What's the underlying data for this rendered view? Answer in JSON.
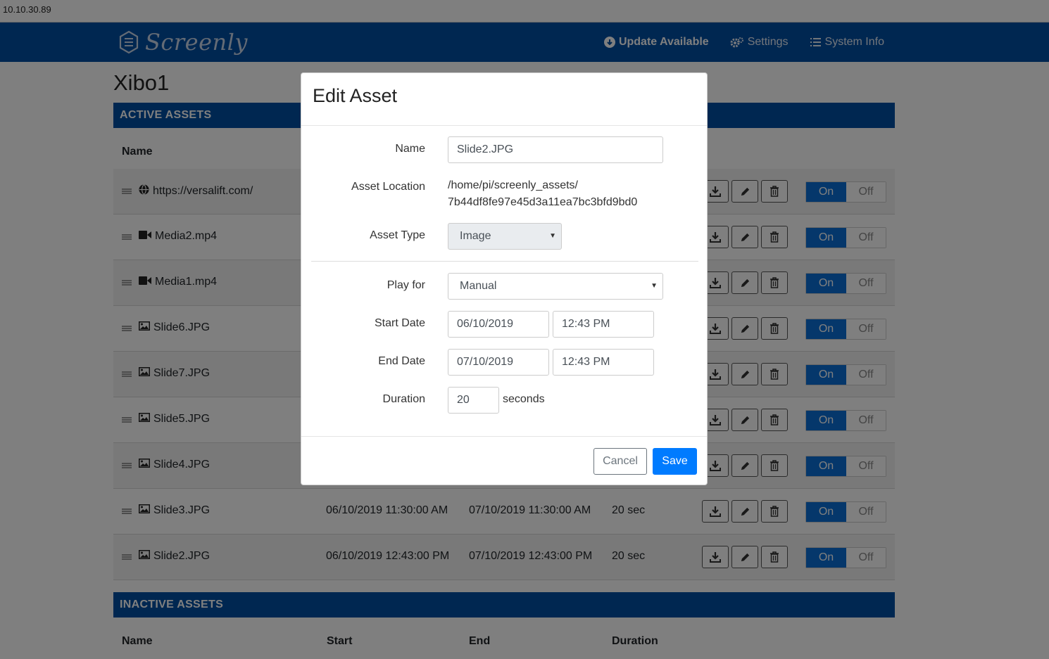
{
  "browser": {
    "address": "10.10.30.89"
  },
  "navbar": {
    "brand": "Screenly",
    "links": [
      {
        "label": "Update Available",
        "icon": "arrow-circle-down-icon",
        "bold": true
      },
      {
        "label": "Settings",
        "icon": "gears-icon"
      },
      {
        "label": "System Info",
        "icon": "list-icon"
      }
    ]
  },
  "page": {
    "title": "Xibo1",
    "active_header": "ACTIVE ASSETS",
    "inactive_header": "INACTIVE ASSETS",
    "columns": {
      "name": "Name",
      "start": "Start",
      "end": "End",
      "duration": "Duration"
    },
    "toggle": {
      "on": "On",
      "off": "Off"
    },
    "assets": [
      {
        "name": "https://versalift.com/",
        "icon": "globe-icon",
        "start": "",
        "end": "",
        "duration": ""
      },
      {
        "name": "Media2.mp4",
        "icon": "video-icon",
        "start": "",
        "end": "",
        "duration": ""
      },
      {
        "name": "Media1.mp4",
        "icon": "video-icon",
        "start": "",
        "end": "",
        "duration": ""
      },
      {
        "name": "Slide6.JPG",
        "icon": "image-icon",
        "start": "",
        "end": "",
        "duration": ""
      },
      {
        "name": "Slide7.JPG",
        "icon": "image-icon",
        "start": "",
        "end": "",
        "duration": ""
      },
      {
        "name": "Slide5.JPG",
        "icon": "image-icon",
        "start": "",
        "end": "",
        "duration": ""
      },
      {
        "name": "Slide4.JPG",
        "icon": "image-icon",
        "start": "",
        "end": "",
        "duration": ""
      },
      {
        "name": "Slide3.JPG",
        "icon": "image-icon",
        "start": "06/10/2019 11:30:00 AM",
        "end": "07/10/2019 11:30:00 AM",
        "duration": "20 sec"
      },
      {
        "name": "Slide2.JPG",
        "icon": "image-icon",
        "start": "06/10/2019 12:43:00 PM",
        "end": "07/10/2019 12:43:00 PM",
        "duration": "20 sec"
      }
    ]
  },
  "modal": {
    "title": "Edit Asset",
    "name_label": "Name",
    "name_value": "Slide2.JPG",
    "location_label": "Asset Location",
    "location_line1": "/home/pi/screenly_assets/",
    "location_line2": "7b44df8fe97e45d3a11ea7bc3bfd9bd0",
    "type_label": "Asset Type",
    "type_value": "Image",
    "playfor_label": "Play for",
    "playfor_value": "Manual",
    "start_label": "Start Date",
    "start_date": "06/10/2019",
    "start_time": "12:43 PM",
    "end_label": "End Date",
    "end_date": "07/10/2019",
    "end_time": "12:43 PM",
    "duration_label": "Duration",
    "duration_value": "20",
    "duration_unit": "seconds",
    "cancel": "Cancel",
    "save": "Save"
  }
}
